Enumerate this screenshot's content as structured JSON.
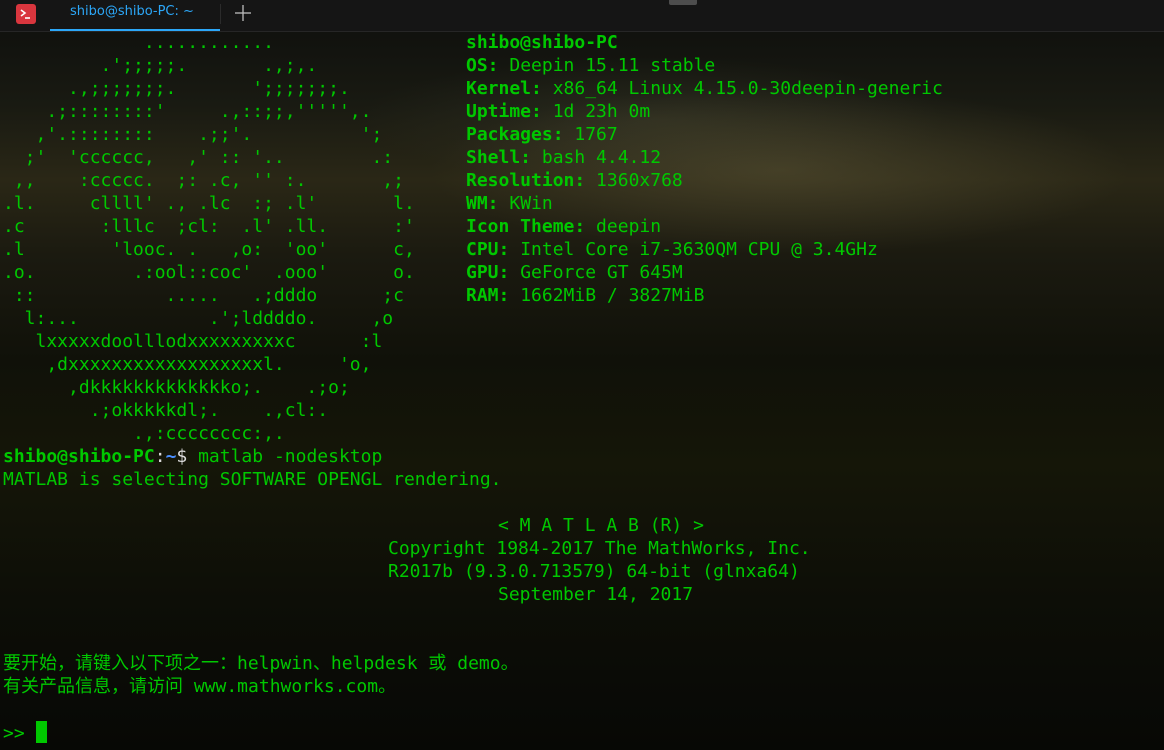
{
  "tabbar": {
    "tab_title": "shibo@shibo-PC: ~",
    "new_tab_icon": "plus-icon",
    "app_icon": "terminal-icon",
    "accent": "#2ca7f8"
  },
  "colors": {
    "text": "#00c800",
    "path": "#4a8fff",
    "prompt_symbol": "#dcdcdc"
  },
  "neofetch": {
    "logo_lines": [
      "             ............",
      "         .';;;;;.       .,;,.",
      "      .,;;;;;;;.       ';;;;;;;.",
      "    .;::::::::'     .,::;;,''''',.",
      "   ,'.::::::::    .;;'.          ';",
      "  ;'  'cccccc,   ,' :: '..        .:",
      " ,,    :ccccc.  ;: .c, '' :.       ,;",
      ".l.     cllll' ., .lc  :; .l'       l.",
      ".c       :lllc  ;cl:  .l' .ll.      :'",
      ".l        'looc. .   ,o:  'oo'      c,",
      ".o.         .:ool::coc'  .ooo'      o.",
      " ::            .....   .;dddo      ;c",
      "  l:...            .';lddddo.     ,o",
      "   lxxxxxdoolllodxxxxxxxxxc      :l",
      "    ,dxxxxxxxxxxxxxxxxxxl.     'o,",
      "      ,dkkkkkkkkkkkkko;.    .;o;",
      "        .;okkkkkdl;.    .,cl:.",
      "            .,:cccccccc:,."
    ],
    "host": "shibo@shibo-PC",
    "info": [
      {
        "key": "OS:",
        "value": " Deepin 15.11 stable"
      },
      {
        "key": "Kernel:",
        "value": " x86_64 Linux 4.15.0-30deepin-generic"
      },
      {
        "key": "Uptime:",
        "value": " 1d 23h 0m"
      },
      {
        "key": "Packages:",
        "value": " 1767"
      },
      {
        "key": "Shell:",
        "value": " bash 4.4.12"
      },
      {
        "key": "Resolution:",
        "value": " 1360x768"
      },
      {
        "key": "WM:",
        "value": " KWin"
      },
      {
        "key": "Icon Theme:",
        "value": " deepin"
      },
      {
        "key": "CPU:",
        "value": " Intel Core i7-3630QM CPU @ 3.4GHz"
      },
      {
        "key": "GPU:",
        "value": " GeForce GT 645M"
      },
      {
        "key": "RAM:",
        "value": " 1662MiB / 3827MiB"
      }
    ]
  },
  "prompt": {
    "user_host": "shibo@shibo-PC",
    "colon": ":",
    "path": "~",
    "symbol": "$",
    "command": " matlab -nodesktop"
  },
  "output": {
    "opengl_msg": "MATLAB is selecting SOFTWARE OPENGL rendering.",
    "banner": "< M A T L A B (R) >",
    "copyright": "Copyright 1984-2017 The MathWorks, Inc.",
    "version": "R2017b (9.3.0.713579) 64-bit (glnxa64)",
    "date": "September 14, 2017",
    "help_line": "要开始，请键入以下项之一：helpwin、helpdesk 或 demo。",
    "info_line": "有关产品信息，请访问 www.mathworks.com。",
    "matlab_prompt": ">> "
  }
}
